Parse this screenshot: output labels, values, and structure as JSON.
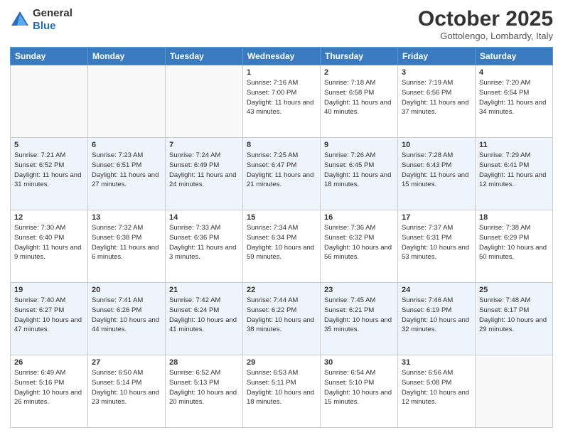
{
  "header": {
    "logo_line1": "General",
    "logo_line2": "Blue",
    "month": "October 2025",
    "location": "Gottolengo, Lombardy, Italy"
  },
  "weekdays": [
    "Sunday",
    "Monday",
    "Tuesday",
    "Wednesday",
    "Thursday",
    "Friday",
    "Saturday"
  ],
  "weeks": [
    [
      {
        "day": "",
        "sunrise": "",
        "sunset": "",
        "daylight": ""
      },
      {
        "day": "",
        "sunrise": "",
        "sunset": "",
        "daylight": ""
      },
      {
        "day": "",
        "sunrise": "",
        "sunset": "",
        "daylight": ""
      },
      {
        "day": "1",
        "sunrise": "Sunrise: 7:16 AM",
        "sunset": "Sunset: 7:00 PM",
        "daylight": "Daylight: 11 hours and 43 minutes."
      },
      {
        "day": "2",
        "sunrise": "Sunrise: 7:18 AM",
        "sunset": "Sunset: 6:58 PM",
        "daylight": "Daylight: 11 hours and 40 minutes."
      },
      {
        "day": "3",
        "sunrise": "Sunrise: 7:19 AM",
        "sunset": "Sunset: 6:56 PM",
        "daylight": "Daylight: 11 hours and 37 minutes."
      },
      {
        "day": "4",
        "sunrise": "Sunrise: 7:20 AM",
        "sunset": "Sunset: 6:54 PM",
        "daylight": "Daylight: 11 hours and 34 minutes."
      }
    ],
    [
      {
        "day": "5",
        "sunrise": "Sunrise: 7:21 AM",
        "sunset": "Sunset: 6:52 PM",
        "daylight": "Daylight: 11 hours and 31 minutes."
      },
      {
        "day": "6",
        "sunrise": "Sunrise: 7:23 AM",
        "sunset": "Sunset: 6:51 PM",
        "daylight": "Daylight: 11 hours and 27 minutes."
      },
      {
        "day": "7",
        "sunrise": "Sunrise: 7:24 AM",
        "sunset": "Sunset: 6:49 PM",
        "daylight": "Daylight: 11 hours and 24 minutes."
      },
      {
        "day": "8",
        "sunrise": "Sunrise: 7:25 AM",
        "sunset": "Sunset: 6:47 PM",
        "daylight": "Daylight: 11 hours and 21 minutes."
      },
      {
        "day": "9",
        "sunrise": "Sunrise: 7:26 AM",
        "sunset": "Sunset: 6:45 PM",
        "daylight": "Daylight: 11 hours and 18 minutes."
      },
      {
        "day": "10",
        "sunrise": "Sunrise: 7:28 AM",
        "sunset": "Sunset: 6:43 PM",
        "daylight": "Daylight: 11 hours and 15 minutes."
      },
      {
        "day": "11",
        "sunrise": "Sunrise: 7:29 AM",
        "sunset": "Sunset: 6:41 PM",
        "daylight": "Daylight: 11 hours and 12 minutes."
      }
    ],
    [
      {
        "day": "12",
        "sunrise": "Sunrise: 7:30 AM",
        "sunset": "Sunset: 6:40 PM",
        "daylight": "Daylight: 11 hours and 9 minutes."
      },
      {
        "day": "13",
        "sunrise": "Sunrise: 7:32 AM",
        "sunset": "Sunset: 6:38 PM",
        "daylight": "Daylight: 11 hours and 6 minutes."
      },
      {
        "day": "14",
        "sunrise": "Sunrise: 7:33 AM",
        "sunset": "Sunset: 6:36 PM",
        "daylight": "Daylight: 11 hours and 3 minutes."
      },
      {
        "day": "15",
        "sunrise": "Sunrise: 7:34 AM",
        "sunset": "Sunset: 6:34 PM",
        "daylight": "Daylight: 10 hours and 59 minutes."
      },
      {
        "day": "16",
        "sunrise": "Sunrise: 7:36 AM",
        "sunset": "Sunset: 6:32 PM",
        "daylight": "Daylight: 10 hours and 56 minutes."
      },
      {
        "day": "17",
        "sunrise": "Sunrise: 7:37 AM",
        "sunset": "Sunset: 6:31 PM",
        "daylight": "Daylight: 10 hours and 53 minutes."
      },
      {
        "day": "18",
        "sunrise": "Sunrise: 7:38 AM",
        "sunset": "Sunset: 6:29 PM",
        "daylight": "Daylight: 10 hours and 50 minutes."
      }
    ],
    [
      {
        "day": "19",
        "sunrise": "Sunrise: 7:40 AM",
        "sunset": "Sunset: 6:27 PM",
        "daylight": "Daylight: 10 hours and 47 minutes."
      },
      {
        "day": "20",
        "sunrise": "Sunrise: 7:41 AM",
        "sunset": "Sunset: 6:26 PM",
        "daylight": "Daylight: 10 hours and 44 minutes."
      },
      {
        "day": "21",
        "sunrise": "Sunrise: 7:42 AM",
        "sunset": "Sunset: 6:24 PM",
        "daylight": "Daylight: 10 hours and 41 minutes."
      },
      {
        "day": "22",
        "sunrise": "Sunrise: 7:44 AM",
        "sunset": "Sunset: 6:22 PM",
        "daylight": "Daylight: 10 hours and 38 minutes."
      },
      {
        "day": "23",
        "sunrise": "Sunrise: 7:45 AM",
        "sunset": "Sunset: 6:21 PM",
        "daylight": "Daylight: 10 hours and 35 minutes."
      },
      {
        "day": "24",
        "sunrise": "Sunrise: 7:46 AM",
        "sunset": "Sunset: 6:19 PM",
        "daylight": "Daylight: 10 hours and 32 minutes."
      },
      {
        "day": "25",
        "sunrise": "Sunrise: 7:48 AM",
        "sunset": "Sunset: 6:17 PM",
        "daylight": "Daylight: 10 hours and 29 minutes."
      }
    ],
    [
      {
        "day": "26",
        "sunrise": "Sunrise: 6:49 AM",
        "sunset": "Sunset: 5:16 PM",
        "daylight": "Daylight: 10 hours and 26 minutes."
      },
      {
        "day": "27",
        "sunrise": "Sunrise: 6:50 AM",
        "sunset": "Sunset: 5:14 PM",
        "daylight": "Daylight: 10 hours and 23 minutes."
      },
      {
        "day": "28",
        "sunrise": "Sunrise: 6:52 AM",
        "sunset": "Sunset: 5:13 PM",
        "daylight": "Daylight: 10 hours and 20 minutes."
      },
      {
        "day": "29",
        "sunrise": "Sunrise: 6:53 AM",
        "sunset": "Sunset: 5:11 PM",
        "daylight": "Daylight: 10 hours and 18 minutes."
      },
      {
        "day": "30",
        "sunrise": "Sunrise: 6:54 AM",
        "sunset": "Sunset: 5:10 PM",
        "daylight": "Daylight: 10 hours and 15 minutes."
      },
      {
        "day": "31",
        "sunrise": "Sunrise: 6:56 AM",
        "sunset": "Sunset: 5:08 PM",
        "daylight": "Daylight: 10 hours and 12 minutes."
      },
      {
        "day": "",
        "sunrise": "",
        "sunset": "",
        "daylight": ""
      }
    ]
  ]
}
